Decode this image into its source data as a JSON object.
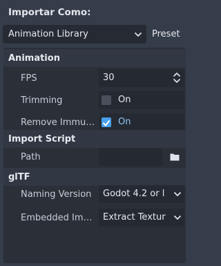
{
  "header": {
    "title": "Importar Como:"
  },
  "import_as": {
    "value": "Animation Library",
    "preset_label": "Preset"
  },
  "sections": {
    "animation": {
      "title": "Animation",
      "fps": {
        "label": "FPS",
        "value": "30"
      },
      "trimming": {
        "label": "Trimming",
        "value": "On",
        "checked": false
      },
      "remove_immutable": {
        "label": "Remove Immu…",
        "value": "On",
        "checked": true
      }
    },
    "import_script": {
      "title": "Import Script",
      "path": {
        "label": "Path",
        "value": ""
      }
    },
    "gltf": {
      "title": "glTF",
      "naming_version": {
        "label": "Naming Version",
        "value": "Godot 4.2 or l"
      },
      "embedded_images": {
        "label": "Embedded Im…",
        "value": "Extract Textur"
      }
    }
  },
  "colors": {
    "background": "#363d4a",
    "panel": "#2a2f38",
    "accent": "#4aa0ee"
  },
  "icons": {
    "dropdown": "chevron-down-icon",
    "spinner": "up-down-arrows-icon",
    "folder": "folder-icon",
    "check": "checkmark-icon"
  }
}
